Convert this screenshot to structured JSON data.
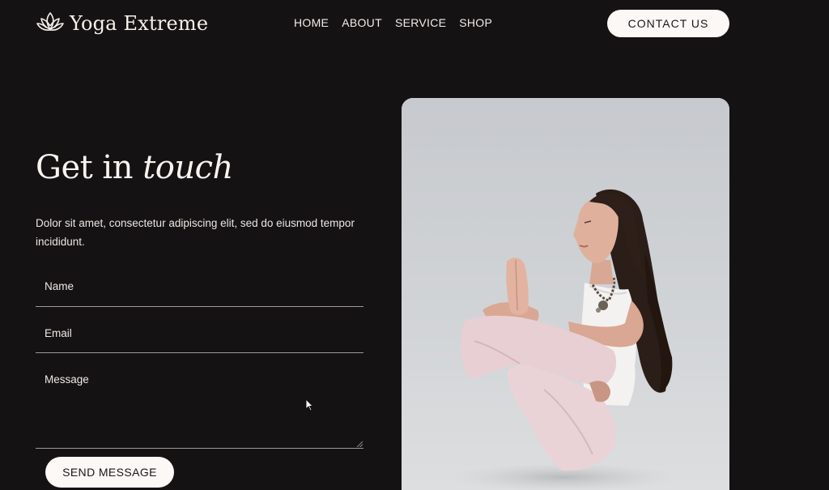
{
  "header": {
    "logo_text": "Yoga Extreme",
    "logo_icon": "lotus-icon",
    "nav": [
      "HOME",
      "ABOUT",
      "SERVICE",
      "SHOP"
    ],
    "contact_label": "CONTACT US"
  },
  "hero": {
    "title_plain": "Get in",
    "title_italic": "touch",
    "description": "Dolor sit amet, consectetur adipiscing elit, sed do eiusmod tempor incididunt."
  },
  "form": {
    "name_placeholder": "Name",
    "email_placeholder": "Email",
    "message_placeholder": "Message",
    "send_label": "SEND MESSAGE"
  },
  "colors": {
    "background": "#141213",
    "button_bg": "#fbf8f5",
    "text": "#f4efe9"
  }
}
